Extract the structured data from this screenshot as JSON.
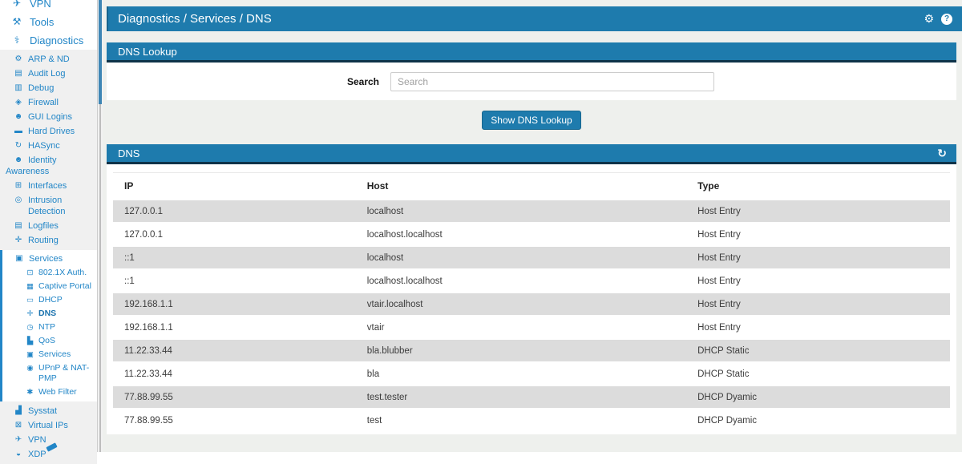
{
  "colors": {
    "accent": "#1e7bad",
    "header_border": "#0e3349",
    "sidebar_link": "#2286c7",
    "table_stripe": "#dcdcdc"
  },
  "sidebar": {
    "top_items": [
      {
        "label": "VPN",
        "icon": "plane-icon",
        "glyph": "✈"
      },
      {
        "label": "Tools",
        "icon": "tools-icon",
        "glyph": "⚒"
      },
      {
        "label": "Diagnostics",
        "icon": "stethoscope-icon",
        "glyph": "⚕"
      }
    ],
    "diagnostics_items": [
      {
        "label": "ARP & ND",
        "icon": "gear-icon",
        "glyph": "⚙"
      },
      {
        "label": "Audit Log",
        "icon": "file-text-icon",
        "glyph": "▤"
      },
      {
        "label": "Debug",
        "icon": "book-icon",
        "glyph": "▥"
      },
      {
        "label": "Firewall",
        "icon": "shield-icon",
        "glyph": "◈"
      },
      {
        "label": "GUI Logins",
        "icon": "user-circle-icon",
        "glyph": "☻"
      },
      {
        "label": "Hard Drives",
        "icon": "hdd-icon",
        "glyph": "▬"
      },
      {
        "label": "HASync",
        "icon": "sync-icon",
        "glyph": "↻"
      },
      {
        "label": "Identity Awareness",
        "icon": "user-plus-icon",
        "glyph": "☻",
        "wrap": true
      },
      {
        "label": "Interfaces",
        "icon": "sitemap-icon",
        "glyph": "⊞"
      },
      {
        "label": "Intrusion Detection",
        "icon": "target-icon",
        "glyph": "◎"
      },
      {
        "label": "Logfiles",
        "icon": "file-text-icon",
        "glyph": "▤"
      },
      {
        "label": "Routing",
        "icon": "move-arrows-icon",
        "glyph": "✛"
      }
    ],
    "services_section": {
      "label": "Services",
      "icon": "briefcase-icon",
      "glyph": "▣"
    },
    "services_items": [
      {
        "label": "802.1X Auth.",
        "icon": "network-nodes-icon",
        "glyph": "⊡"
      },
      {
        "label": "Captive Portal",
        "icon": "image-icon",
        "glyph": "▦"
      },
      {
        "label": "DHCP",
        "icon": "desktop-icon",
        "glyph": "▭"
      },
      {
        "label": "DNS",
        "icon": "move-arrows-icon",
        "glyph": "✛",
        "active": true
      },
      {
        "label": "NTP",
        "icon": "clock-icon",
        "glyph": "◷"
      },
      {
        "label": "QoS",
        "icon": "bar-chart-icon",
        "glyph": "▙"
      },
      {
        "label": "Services",
        "icon": "briefcase-icon",
        "glyph": "▣"
      },
      {
        "label": "UPnP & NAT-PMP",
        "icon": "map-marker-icon",
        "glyph": "◉"
      },
      {
        "label": "Web Filter",
        "icon": "asterisk-icon",
        "glyph": "✱"
      }
    ],
    "bottom_items": [
      {
        "label": "Sysstat",
        "icon": "area-chart-icon",
        "glyph": "▟"
      },
      {
        "label": "Virtual IPs",
        "icon": "virtual-ip-icon",
        "glyph": "⊠"
      },
      {
        "label": "VPN",
        "icon": "plane-icon",
        "glyph": "✈"
      },
      {
        "label": "XDP",
        "icon": "tachometer-icon",
        "glyph": "◒"
      }
    ]
  },
  "header": {
    "breadcrumb": "Diagnostics / Services / DNS",
    "gear_icon": "⚙",
    "help_icon": "?"
  },
  "lookup_panel": {
    "title": "DNS Lookup",
    "search_label": "Search",
    "search_value": "",
    "search_placeholder": "Search",
    "button_label": "Show DNS Lookup"
  },
  "dns_panel": {
    "title": "DNS",
    "refresh_icon": "↻",
    "columns": [
      "IP",
      "Host",
      "Type"
    ],
    "rows": [
      [
        "127.0.0.1",
        "localhost",
        "Host Entry"
      ],
      [
        "127.0.0.1",
        "localhost.localhost",
        "Host Entry"
      ],
      [
        "::1",
        "localhost",
        "Host Entry"
      ],
      [
        "::1",
        "localhost.localhost",
        "Host Entry"
      ],
      [
        "192.168.1.1",
        "vtair.localhost",
        "Host Entry"
      ],
      [
        "192.168.1.1",
        "vtair",
        "Host Entry"
      ],
      [
        "11.22.33.44",
        "bla.blubber",
        "DHCP Static"
      ],
      [
        "11.22.33.44",
        "bla",
        "DHCP Static"
      ],
      [
        "77.88.99.55",
        "test.tester",
        "DHCP Dyamic"
      ],
      [
        "77.88.99.55",
        "test",
        "DHCP Dyamic"
      ]
    ]
  }
}
